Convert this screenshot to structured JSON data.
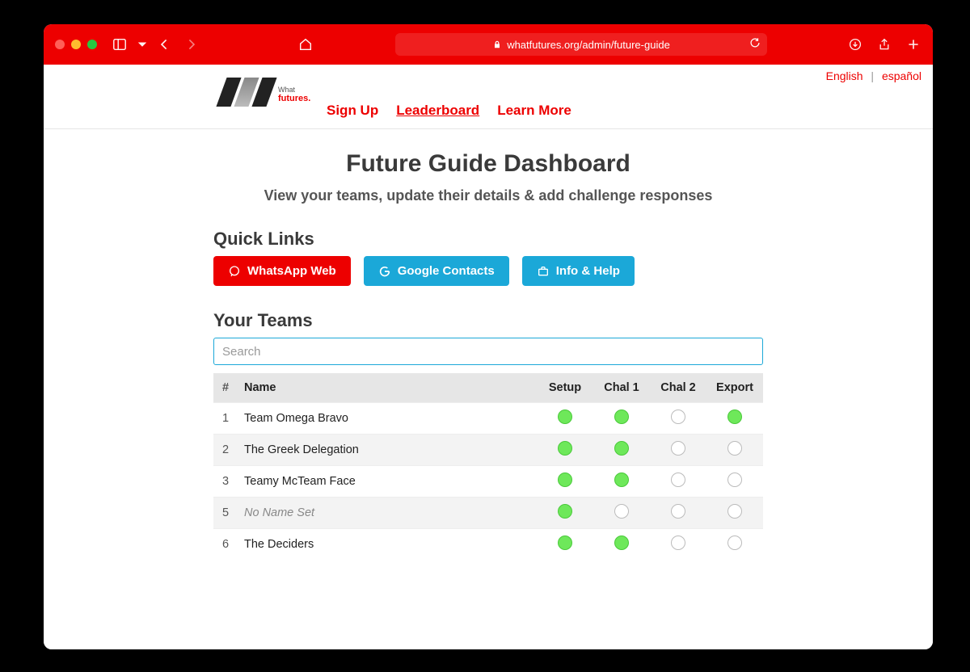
{
  "browser": {
    "url": "whatfutures.org/admin/future-guide"
  },
  "lang": {
    "english": "English",
    "spanish": "español"
  },
  "logo": {
    "line1": "What",
    "line2": "futures."
  },
  "nav": {
    "signup": "Sign Up",
    "leaderboard": "Leaderboard",
    "learnmore": "Learn More"
  },
  "page": {
    "title": "Future Guide Dashboard",
    "subtitle": "View your teams, update their details & add challenge responses"
  },
  "quick": {
    "heading": "Quick Links",
    "whatsapp": "WhatsApp Web",
    "google": "Google Contacts",
    "info": "Info & Help"
  },
  "teams": {
    "heading": "Your Teams",
    "search_placeholder": "Search",
    "cols": {
      "num": "#",
      "name": "Name",
      "setup": "Setup",
      "chal1": "Chal 1",
      "chal2": "Chal 2",
      "export": "Export"
    },
    "rows": [
      {
        "num": "1",
        "name": "Team Omega Bravo",
        "italic": false,
        "setup": true,
        "chal1": true,
        "chal2": false,
        "export": true
      },
      {
        "num": "2",
        "name": "The Greek Delegation",
        "italic": false,
        "setup": true,
        "chal1": true,
        "chal2": false,
        "export": false
      },
      {
        "num": "3",
        "name": "Teamy McTeam Face",
        "italic": false,
        "setup": true,
        "chal1": true,
        "chal2": false,
        "export": false
      },
      {
        "num": "5",
        "name": "No Name Set",
        "italic": true,
        "setup": true,
        "chal1": false,
        "chal2": false,
        "export": false
      },
      {
        "num": "6",
        "name": "The Deciders",
        "italic": false,
        "setup": true,
        "chal1": true,
        "chal2": false,
        "export": false
      }
    ]
  }
}
